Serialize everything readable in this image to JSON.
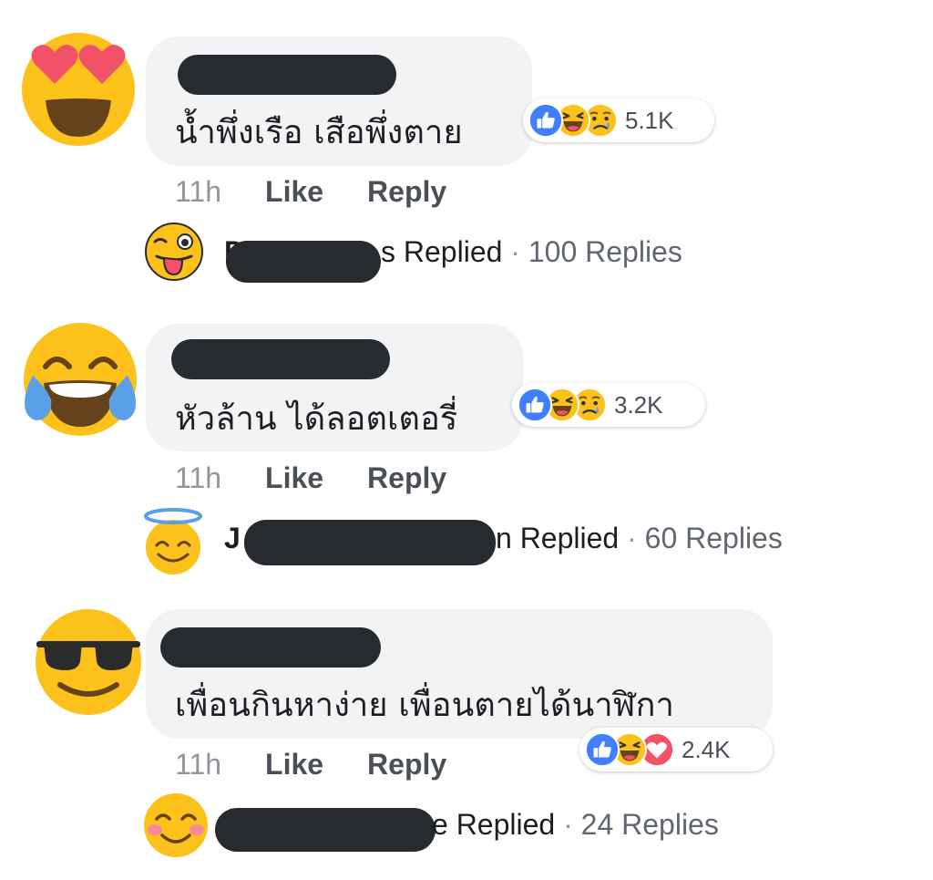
{
  "colors": {
    "bubble": "#f2f3f5",
    "redaction": "#272b30",
    "like_blue": "#4080ff",
    "emoji_yellow": "#fcc21b",
    "love_red": "#f25268",
    "muted_text": "#90949c"
  },
  "comments": [
    {
      "avatar_icon": "heart-eyes-emoji-icon",
      "text": "น้ำพึ่งเรือ เสือพึ่งตาย",
      "reactions": [
        "like-reaction-icon",
        "haha-reaction-icon",
        "sad-reaction-icon"
      ],
      "reaction_count": "5.1K",
      "time": "11h",
      "like_label": "Like",
      "reply_label": "Reply",
      "reply_avatar_icon": "winking-tongue-emoji-icon",
      "reply_name_initial": "D",
      "reply_name_tail": "s",
      "replied_label": "Replied",
      "separator": "·",
      "replies_count_label": "100 Replies"
    },
    {
      "avatar_icon": "tears-of-joy-emoji-icon",
      "text": "หัวล้าน ได้ลอตเตอรี่",
      "reactions": [
        "like-reaction-icon",
        "haha-reaction-icon",
        "sad-reaction-icon"
      ],
      "reaction_count": "3.2K",
      "time": "11h",
      "like_label": "Like",
      "reply_label": "Reply",
      "reply_avatar_icon": "halo-smile-emoji-icon",
      "reply_name_initial": "J",
      "reply_name_tail": "n",
      "replied_label": "Replied",
      "separator": "·",
      "replies_count_label": "60 Replies"
    },
    {
      "avatar_icon": "sunglasses-emoji-icon",
      "text": "เพื่อนกินหาง่าย เพื่อนตายได้นาฬิกา",
      "reactions": [
        "like-reaction-icon",
        "haha-reaction-icon",
        "love-reaction-icon"
      ],
      "reaction_count": "2.4K",
      "time": "11h",
      "like_label": "Like",
      "reply_label": "Reply",
      "reply_avatar_icon": "blushing-smile-emoji-icon",
      "reply_name_initial": "",
      "reply_name_tail": "e",
      "replied_label": "Replied",
      "separator": "·",
      "replies_count_label": "24 Replies"
    }
  ]
}
